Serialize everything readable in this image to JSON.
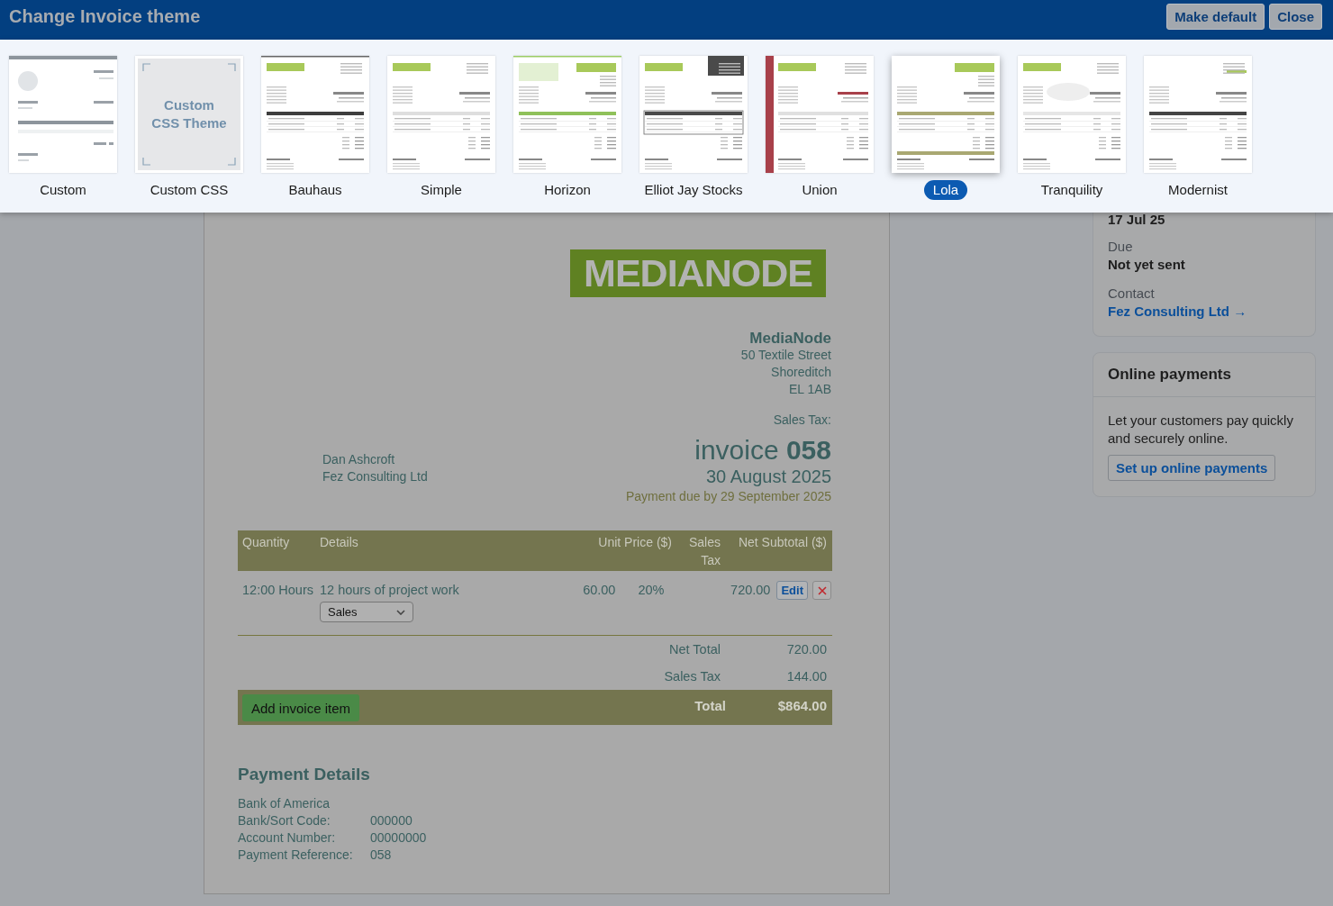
{
  "header": {
    "title": "Change Invoice theme",
    "buttons": [
      "Make default",
      "Close"
    ]
  },
  "themes": [
    {
      "label": "Custom",
      "kind": "wireframe",
      "selected": false
    },
    {
      "label": "Custom CSS",
      "kind": "css",
      "thumbnail_text": "Custom CSS Theme",
      "selected": false
    },
    {
      "label": "Bauhaus",
      "kind": "bauhaus",
      "selected": false
    },
    {
      "label": "Simple",
      "kind": "simple",
      "selected": false
    },
    {
      "label": "Horizon",
      "kind": "horizon",
      "selected": false
    },
    {
      "label": "Elliot Jay Stocks",
      "kind": "elliot",
      "selected": false
    },
    {
      "label": "Union",
      "kind": "union",
      "selected": false
    },
    {
      "label": "Lola",
      "kind": "lola",
      "selected": true
    },
    {
      "label": "Tranquility",
      "kind": "tranquility",
      "selected": false
    },
    {
      "label": "Modernist",
      "kind": "modernist",
      "selected": false
    }
  ],
  "invoice": {
    "logo": "MEDIANODE",
    "company": {
      "name": "MediaNode",
      "address": [
        "50 Textile Street",
        "Shoreditch",
        "EL 1AB"
      ]
    },
    "sales_tax_label": "Sales Tax:",
    "client": [
      "Dan Ashcroft",
      "Fez Consulting Ltd"
    ],
    "title": "invoice **058**",
    "date": "30 August 2025",
    "due": "Payment due by 29 September 2025",
    "table": {
      "columns": [
        "Quantity",
        "Details",
        "Unit Price ($)",
        "Sales Tax",
        "Net Subtotal ($)"
      ],
      "rows": [
        {
          "quantity": "12:00 Hours",
          "details": "12 hours of project work",
          "category": "Sales",
          "unit_price": "60.00",
          "sales_tax": "20%",
          "net_subtotal": "720.00",
          "edit": "Edit"
        }
      ]
    },
    "totals": [
      {
        "label": "Net Total",
        "value": "720.00"
      },
      {
        "label": "Sales Tax",
        "value": "144.00"
      }
    ],
    "grand_total": {
      "label": "Total",
      "value": "$864.00"
    },
    "add_item_button": "Add invoice item",
    "payment_details": {
      "title": "Payment Details",
      "bank": "Bank of America",
      "fields": [
        {
          "label": "Bank/Sort Code:",
          "value": "000000"
        },
        {
          "label": "Account Number:",
          "value": "00000000"
        },
        {
          "label": "Payment Reference:",
          "value": "058"
        }
      ]
    }
  },
  "sidebar": {
    "summary": {
      "date": "17 Jul 25",
      "fields": [
        {
          "label": "Due",
          "value": "Not yet sent",
          "kind": "text"
        },
        {
          "label": "Contact",
          "value": "Fez Consulting Ltd →",
          "kind": "link"
        }
      ]
    },
    "online_payments": {
      "title": "Online payments",
      "text": "Let your customers pay quickly and securely online.",
      "button": "Set up online payments"
    }
  }
}
